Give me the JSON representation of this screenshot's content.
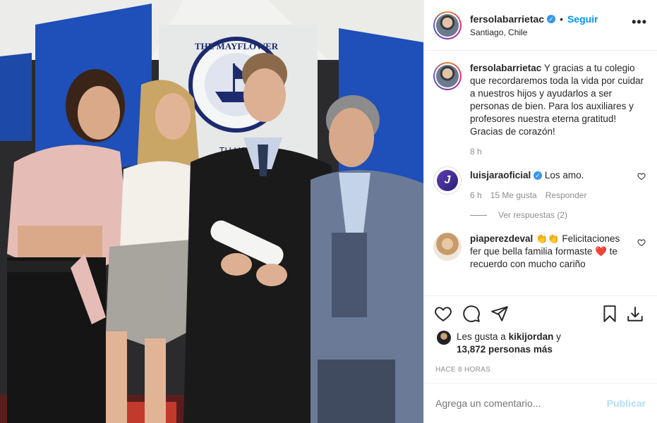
{
  "header": {
    "username": "fersolabarrietac",
    "verified_mark": "✓",
    "separator": "•",
    "follow_label": "Seguir",
    "location": "Santiago, Chile",
    "more_label": "•••"
  },
  "caption": {
    "username": "fersolabarrietac",
    "text": "Y gracias a tu colegio que recordaremos toda la vida por cuidar a nuestros hijos y ayudarlos a ser personas de bien. Para los auxiliares y profesores nuestra eterna gratitud! Gracias de corazón!",
    "time": "8 h"
  },
  "comments": [
    {
      "username": "luisjaraoficial",
      "avatar_letter": "J",
      "text": "Los amo.",
      "time": "6 h",
      "likes": "15 Me gusta",
      "reply": "Responder",
      "view_replies": "Ver respuestas (2)"
    },
    {
      "username": "piaperezdeval",
      "text": "👏👏 Felicitaciones fer que bella familia formaste ❤️ te recuerdo con mucho cariño"
    }
  ],
  "likes": {
    "prefix": "Les gusta a",
    "user": "kikijordan",
    "joiner": "y",
    "count": "13,872 personas más"
  },
  "timestamp": "HACE 8 HORAS",
  "comment_box": {
    "placeholder": "Agrega un comentario...",
    "publish_label": "Publicar"
  },
  "photo": {
    "banner_text": "THE MAYFLOWER",
    "banner_subtext": "TH US"
  },
  "colors": {
    "accent": "#0095f6",
    "publish_disabled": "#b2dffc",
    "muted": "#8e8e8e",
    "verified": "#3897f0"
  }
}
